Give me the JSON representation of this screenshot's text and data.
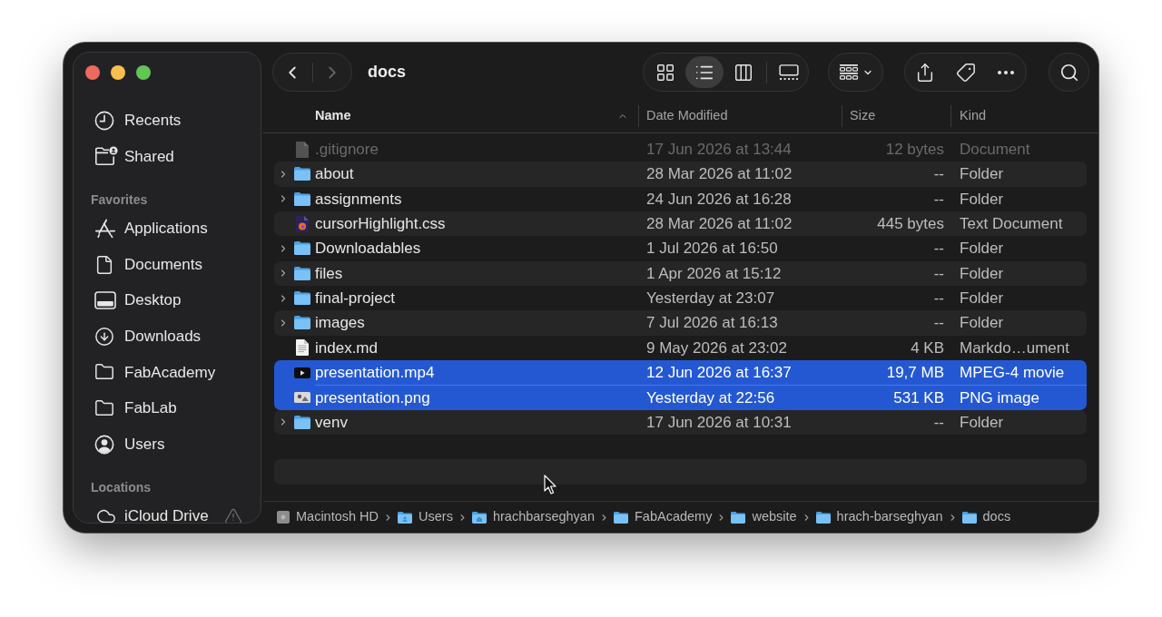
{
  "sidebar": {
    "items": [
      {
        "label": "Recents",
        "kind": "clock",
        "selected": false,
        "warning": false
      },
      {
        "label": "Shared",
        "kind": "shared",
        "selected": false,
        "warning": false
      }
    ],
    "sections": [
      {
        "title": "Favorites",
        "items": [
          {
            "label": "Applications",
            "kind": "apps",
            "selected": false,
            "warning": false
          },
          {
            "label": "Documents",
            "kind": "document",
            "selected": false,
            "warning": false
          },
          {
            "label": "Desktop",
            "kind": "desktop",
            "selected": false,
            "warning": false
          },
          {
            "label": "Downloads",
            "kind": "downloads",
            "selected": false,
            "warning": false
          },
          {
            "label": "FabAcademy",
            "kind": "folder",
            "selected": false,
            "warning": false
          },
          {
            "label": "FabLab",
            "kind": "folder",
            "selected": false,
            "warning": false
          },
          {
            "label": "Users",
            "kind": "user",
            "selected": false,
            "warning": false
          }
        ]
      },
      {
        "title": "Locations",
        "items": [
          {
            "label": "iCloud Drive",
            "kind": "cloud",
            "selected": false,
            "warning": true
          }
        ]
      }
    ]
  },
  "toolbar": {
    "back": {
      "disabled": false
    },
    "forward": {
      "disabled": true
    },
    "title": "docs",
    "view_modes": [
      {
        "kind": "icons",
        "selected": false
      },
      {
        "kind": "list",
        "selected": true
      },
      {
        "kind": "columns",
        "selected": false
      },
      {
        "kind": "gallery",
        "selected": false
      }
    ]
  },
  "table": {
    "columns": [
      {
        "label": "Name",
        "sorted": true
      },
      {
        "label": "Date Modified",
        "sorted": false
      },
      {
        "label": "Size",
        "sorted": false
      },
      {
        "label": "Kind",
        "sorted": false
      }
    ],
    "rows": [
      {
        "name": ".gitignore",
        "kind": "document",
        "date_modified": "17 Jun 2026 at 13:44",
        "size": "12 bytes",
        "file_kind": "Document",
        "selected": false,
        "dimmed": true
      },
      {
        "name": "about",
        "kind": "folder",
        "expanded": false,
        "date_modified": "28 Mar 2026 at 11:02",
        "size": "--",
        "file_kind": "Folder",
        "selected": false,
        "dimmed": false
      },
      {
        "name": "assignments",
        "kind": "folder",
        "expanded": false,
        "date_modified": "24 Jun 2026 at 16:28",
        "size": "--",
        "file_kind": "Folder",
        "selected": false,
        "dimmed": false
      },
      {
        "name": "cursorHighlight.css",
        "kind": "css",
        "date_modified": "28 Mar 2026 at 11:02",
        "size": "445 bytes",
        "file_kind": "Text Document",
        "selected": false,
        "dimmed": false
      },
      {
        "name": "Downloadables",
        "kind": "folder",
        "expanded": false,
        "date_modified": "1 Jul 2026 at 16:50",
        "size": "--",
        "file_kind": "Folder",
        "selected": false,
        "dimmed": false
      },
      {
        "name": "files",
        "kind": "folder",
        "expanded": false,
        "date_modified": "1 Apr 2026 at 15:12",
        "size": "--",
        "file_kind": "Folder",
        "selected": false,
        "dimmed": false
      },
      {
        "name": "final-project",
        "kind": "folder",
        "expanded": false,
        "date_modified": "Yesterday at 23:07",
        "size": "--",
        "file_kind": "Folder",
        "selected": false,
        "dimmed": false
      },
      {
        "name": "images",
        "kind": "folder",
        "expanded": false,
        "date_modified": "7 Jul 2026 at 16:13",
        "size": "--",
        "file_kind": "Folder",
        "selected": false,
        "dimmed": false
      },
      {
        "name": "index.md",
        "kind": "markdown",
        "date_modified": "9 May 2026 at 23:02",
        "size": "4 KB",
        "file_kind": "Markdo…ument",
        "selected": false,
        "dimmed": false
      },
      {
        "name": "presentation.mp4",
        "kind": "movie",
        "date_modified": "12 Jun 2026 at 16:37",
        "size": "19,7 MB",
        "file_kind": "MPEG-4 movie",
        "selected": true,
        "dimmed": false
      },
      {
        "name": "presentation.png",
        "kind": "image",
        "date_modified": "Yesterday at 22:56",
        "size": "531 KB",
        "file_kind": "PNG image",
        "selected": true,
        "dimmed": false
      },
      {
        "name": "venv",
        "kind": "folder",
        "expanded": false,
        "date_modified": "17 Jun 2026 at 10:31",
        "size": "--",
        "file_kind": "Folder",
        "selected": false,
        "dimmed": false
      }
    ]
  },
  "path_bar": {
    "items": [
      {
        "label": "Macintosh HD",
        "kind": "disk"
      },
      {
        "label": "Users",
        "kind": "users"
      },
      {
        "label": "hrachbarseghyan",
        "kind": "home"
      },
      {
        "label": "FabAcademy",
        "kind": "folder"
      },
      {
        "label": "website",
        "kind": "folder"
      },
      {
        "label": "hrach-barseghyan",
        "kind": "folder"
      },
      {
        "label": "docs",
        "kind": "folder"
      }
    ]
  }
}
